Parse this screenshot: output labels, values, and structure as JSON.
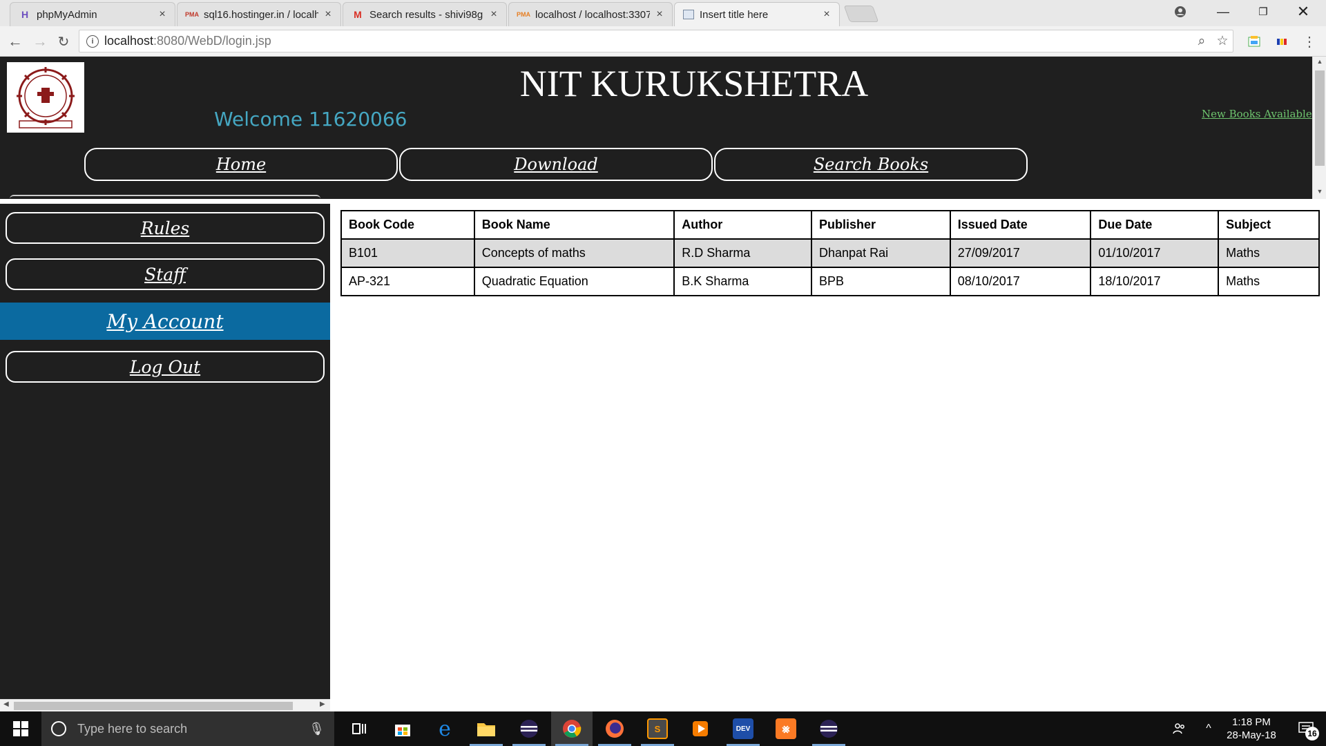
{
  "browser": {
    "tabs": [
      {
        "title": "phpMyAdmin",
        "icon": "phpmyadmin-icon",
        "active": false
      },
      {
        "title": "sql16.hostinger.in / localh",
        "icon": "pma-icon",
        "active": false
      },
      {
        "title": "Search results - shivi98g",
        "icon": "gmail-icon",
        "active": false
      },
      {
        "title": "localhost / localhost:3307",
        "icon": "pma-icon",
        "active": false
      },
      {
        "title": "Insert title here",
        "icon": "page-icon",
        "active": true
      }
    ],
    "url_host": "localhost",
    "url_path": ":8080/WebD/login.jsp"
  },
  "header": {
    "title": "NIT KURUKSHETRA",
    "welcome": "Welcome 11620066",
    "new_books_link": "New Books Available",
    "nav": [
      "Home",
      "Download",
      "Search Books"
    ]
  },
  "sidebar": {
    "items": [
      "Rules",
      "Staff",
      "My Account",
      "Log Out"
    ],
    "active": "My Account"
  },
  "books_table": {
    "headers": [
      "Book Code",
      "Book Name",
      "Author",
      "Publisher",
      "Issued Date",
      "Due Date",
      "Subject"
    ],
    "rows": [
      [
        "B101",
        "Concepts of maths",
        "R.D Sharma",
        "Dhanpat Rai",
        "27/09/2017",
        "01/10/2017",
        "Maths"
      ],
      [
        "AP-321",
        "Quadratic Equation",
        "B.K Sharma",
        "BPB",
        "08/10/2017",
        "18/10/2017",
        "Maths"
      ]
    ]
  },
  "taskbar": {
    "search_placeholder": "Type here to search",
    "time": "1:18 PM",
    "date": "28-May-18",
    "notification_count": "16",
    "apps": [
      "task-view",
      "store",
      "edge",
      "file-explorer",
      "eclipse",
      "chrome",
      "firefox",
      "sublime",
      "media-player",
      "devcpp",
      "xampp",
      "eclipse"
    ]
  },
  "colors": {
    "header_bg": "#1f1f1f",
    "welcome": "#45a7c2",
    "active_nav": "#0b6aa0",
    "new_books": "#6ec46e"
  }
}
